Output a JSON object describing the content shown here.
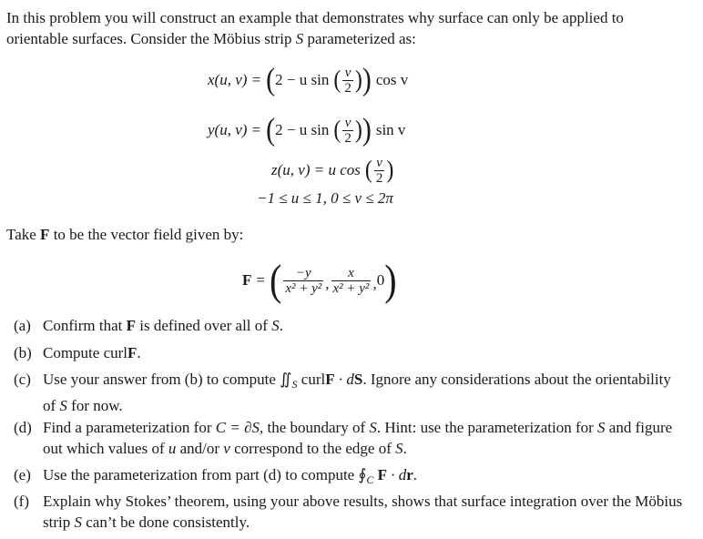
{
  "intro": {
    "text_before_S": "In this problem you will construct an example that demonstrates why surface can only be applied to orientable surfaces. Consider the Möbius strip ",
    "S": "S",
    "text_after_S": " parameterized as:"
  },
  "parameterization": {
    "x_lhs": "x(u, v) =",
    "x_trig": "cos v",
    "y_lhs": "y(u, v) =",
    "y_trig": "sin v",
    "z_lhs": "z(u, v) = u cos",
    "inner": "2 − u sin",
    "frac_num": "v",
    "frac_den": "2",
    "domain": "−1 ≤ u ≤ 1, 0 ≤ v ≤ 2π"
  },
  "field_intro": {
    "before": "Take ",
    "F": "F",
    "after": " to be the vector field given by:"
  },
  "field": {
    "lhs": "F",
    "eq": "=",
    "num1": "−y",
    "den1": "x² + y²",
    "num2": "x",
    "den2": "x² + y²",
    "third": "0"
  },
  "parts": [
    {
      "label": "(a)",
      "pre": "Confirm that ",
      "F": "F",
      "mid": " is defined over all of ",
      "S": "S",
      "post": "."
    },
    {
      "label": "(b)",
      "pre": "Compute curl",
      "F": "F",
      "post": "."
    },
    {
      "label": "(c)",
      "pre": "Use your answer from (b) to compute ",
      "integral": "∬",
      "sub": "S",
      "expr1": " curl",
      "F": "F",
      "dot": " · d",
      "dS": "S",
      "post": ". Ignore any considerations about the orientability of ",
      "S": "S",
      "post2": " for now."
    },
    {
      "label": "(d)",
      "pre": "Find a parameterization for ",
      "C": "C = ∂S",
      "mid": ", the boundary of ",
      "S": "S",
      "mid2": ". Hint: use the parameterization for ",
      "S2": "S",
      "mid3": " and figure out which values of ",
      "u": "u",
      "mid4": " and/or ",
      "v": "v",
      "mid5": " correspond to the edge of ",
      "S3": "S",
      "post": "."
    },
    {
      "label": "(e)",
      "pre": "Use the parameterization from part (d) to compute ",
      "integral": "∮",
      "sub": "C",
      "F": "F",
      "dot": " · d",
      "r": "r",
      "post": "."
    },
    {
      "label": "(f)",
      "pre": "Explain why Stokes’ theorem, using your above results, shows that surface integration over the Möbius strip ",
      "S": "S",
      "post": " can’t be done consistently."
    }
  ]
}
